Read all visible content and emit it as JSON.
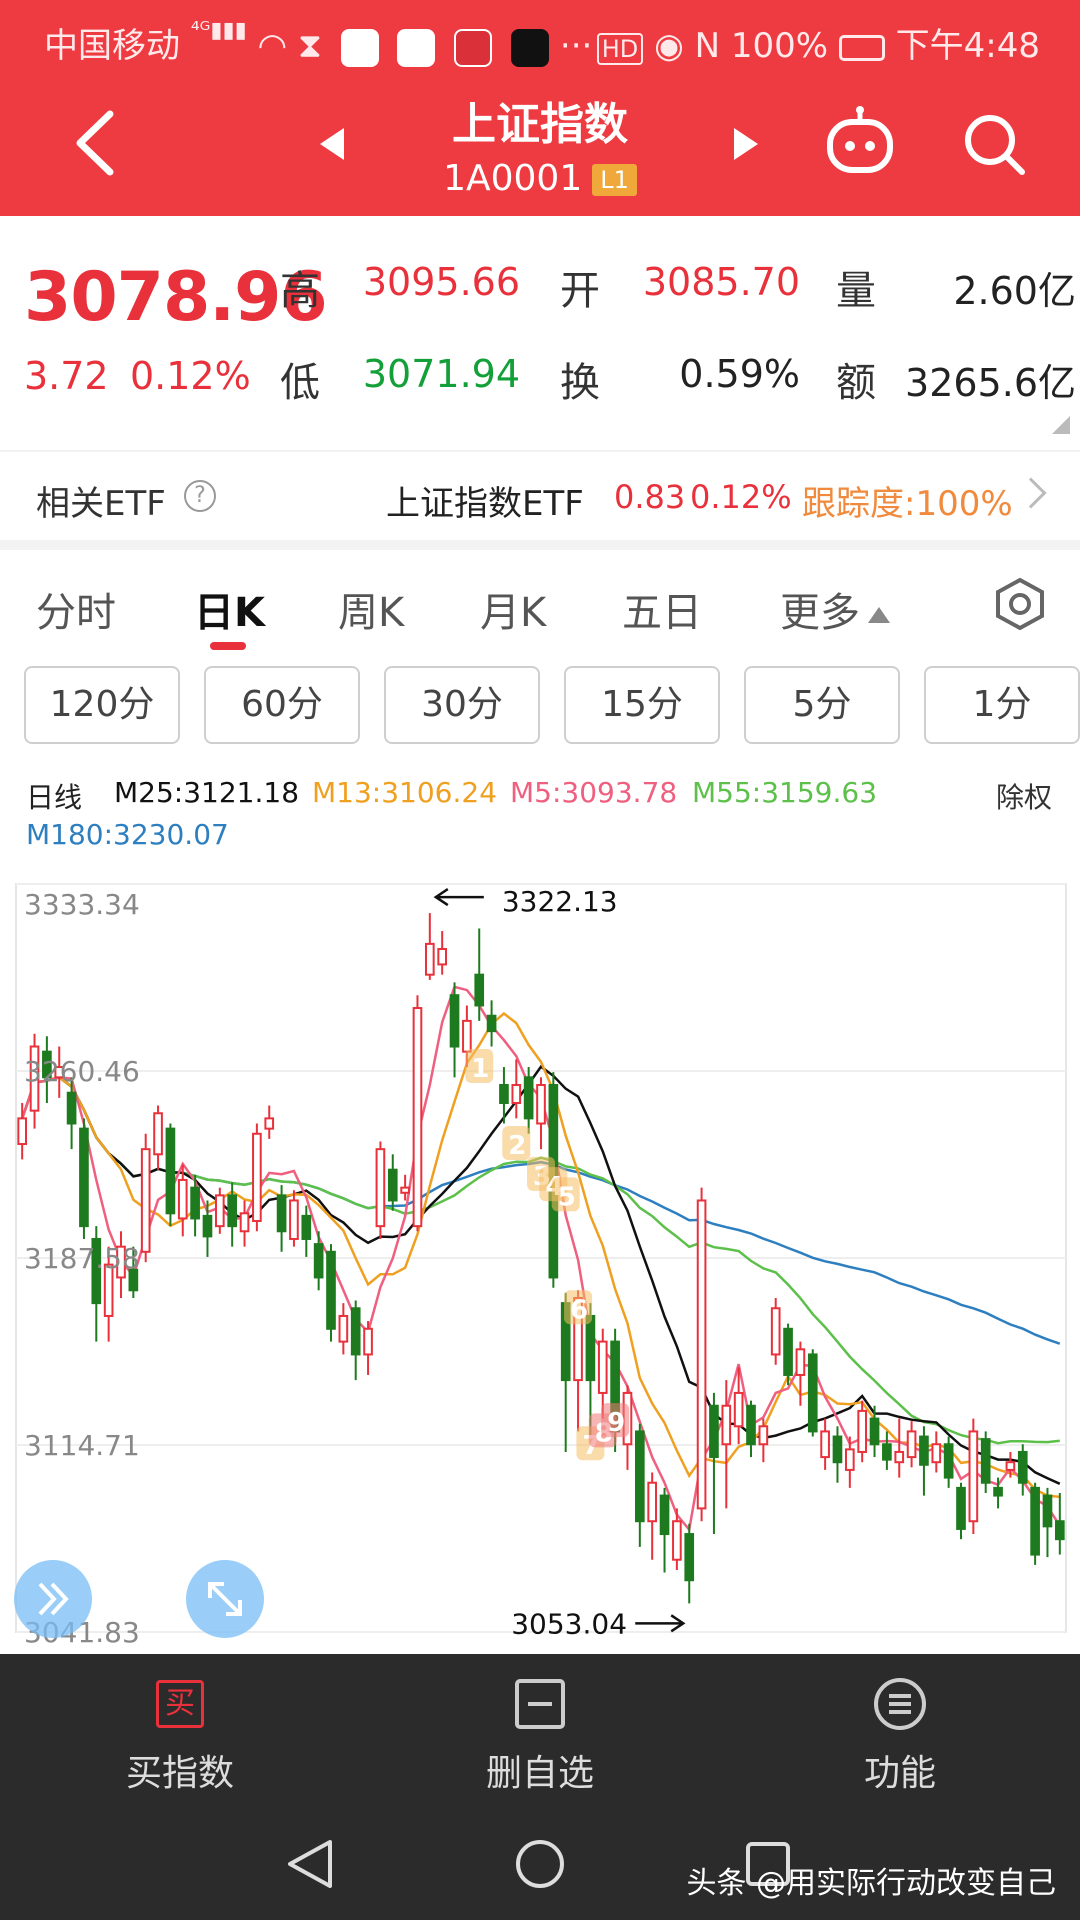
{
  "status_bar": {
    "carrier": "中国移动",
    "battery": "100%",
    "time": "下午4:48"
  },
  "header": {
    "title": "上证指数",
    "code": "1A0001",
    "level_badge": "L1"
  },
  "quote": {
    "price": "3078.96",
    "change": "3.72",
    "change_pct": "0.12%",
    "high_label": "高",
    "high": "3095.66",
    "low_label": "低",
    "low": "3071.94",
    "open_label": "开",
    "open": "3085.70",
    "turnover_label": "换",
    "turnover": "0.59%",
    "volume_label": "量",
    "volume": "2.60亿",
    "amount_label": "额",
    "amount": "3265.6亿"
  },
  "etf": {
    "label": "相关ETF",
    "name": "上证指数ETF",
    "price": "0.83",
    "pct": "0.12%",
    "tracking": "跟踪度:100%"
  },
  "tabs": [
    "分时",
    "日K",
    "周K",
    "月K",
    "五日",
    "更多"
  ],
  "minute_buttons": [
    "120分",
    "60分",
    "30分",
    "15分",
    "5分",
    "1分"
  ],
  "ma_legend": {
    "title": "日线",
    "adjust": "除权",
    "m25": "M25:3121.18",
    "m13": "M13:3106.24",
    "m5": "M5:3093.78",
    "m55": "M55:3159.63",
    "m180": "M180:3230.07"
  },
  "colors": {
    "up": "#e8313b",
    "down": "#1e7a1e",
    "m25": "#111111",
    "m13": "#f0a020",
    "m5": "#ef5f7f",
    "m55": "#5cc04a",
    "m180": "#2e7fc0"
  },
  "chart_data": {
    "type": "candlestick",
    "y_ticks": [
      "3333.34",
      "3260.46",
      "3187.58",
      "3114.71",
      "3041.83"
    ],
    "ylim": [
      3041.83,
      3333.34
    ],
    "annotations": {
      "high": "3322.13",
      "low": "3053.04"
    },
    "wave_labels": [
      "1",
      "2",
      "3",
      "4",
      "5",
      "6",
      "7",
      "8",
      "9"
    ],
    "candles": [
      {
        "o": 3232,
        "c": 3242,
        "h": 3248,
        "l": 3226
      },
      {
        "o": 3245,
        "c": 3270,
        "h": 3275,
        "l": 3238
      },
      {
        "o": 3268,
        "c": 3258,
        "h": 3274,
        "l": 3248
      },
      {
        "o": 3258,
        "c": 3262,
        "h": 3270,
        "l": 3250
      },
      {
        "o": 3252,
        "c": 3240,
        "h": 3258,
        "l": 3230
      },
      {
        "o": 3238,
        "c": 3200,
        "h": 3242,
        "l": 3195
      },
      {
        "o": 3195,
        "c": 3170,
        "h": 3200,
        "l": 3155
      },
      {
        "o": 3165,
        "c": 3185,
        "h": 3192,
        "l": 3155
      },
      {
        "o": 3180,
        "c": 3192,
        "h": 3198,
        "l": 3172
      },
      {
        "o": 3183,
        "c": 3175,
        "h": 3192,
        "l": 3172
      },
      {
        "o": 3190,
        "c": 3230,
        "h": 3236,
        "l": 3186
      },
      {
        "o": 3228,
        "c": 3244,
        "h": 3247,
        "l": 3222
      },
      {
        "o": 3238,
        "c": 3205,
        "h": 3240,
        "l": 3200
      },
      {
        "o": 3203,
        "c": 3218,
        "h": 3224,
        "l": 3196
      },
      {
        "o": 3215,
        "c": 3203,
        "h": 3220,
        "l": 3196
      },
      {
        "o": 3204,
        "c": 3196,
        "h": 3210,
        "l": 3188
      },
      {
        "o": 3200,
        "c": 3212,
        "h": 3215,
        "l": 3197
      },
      {
        "o": 3212,
        "c": 3200,
        "h": 3217,
        "l": 3192
      },
      {
        "o": 3198,
        "c": 3205,
        "h": 3210,
        "l": 3192
      },
      {
        "o": 3202,
        "c": 3236,
        "h": 3240,
        "l": 3198
      },
      {
        "o": 3238,
        "c": 3242,
        "h": 3247,
        "l": 3234
      },
      {
        "o": 3212,
        "c": 3198,
        "h": 3216,
        "l": 3190
      },
      {
        "o": 3195,
        "c": 3210,
        "h": 3214,
        "l": 3192
      },
      {
        "o": 3204,
        "c": 3195,
        "h": 3208,
        "l": 3188
      },
      {
        "o": 3193,
        "c": 3180,
        "h": 3198,
        "l": 3175
      },
      {
        "o": 3190,
        "c": 3160,
        "h": 3193,
        "l": 3155
      },
      {
        "o": 3155,
        "c": 3165,
        "h": 3170,
        "l": 3150
      },
      {
        "o": 3168,
        "c": 3150,
        "h": 3171,
        "l": 3140
      },
      {
        "o": 3150,
        "c": 3160,
        "h": 3163,
        "l": 3142
      },
      {
        "o": 3200,
        "c": 3230,
        "h": 3233,
        "l": 3195
      },
      {
        "o": 3222,
        "c": 3210,
        "h": 3228,
        "l": 3206
      },
      {
        "o": 3213,
        "c": 3215,
        "h": 3220,
        "l": 3210
      },
      {
        "o": 3200,
        "c": 3285,
        "h": 3290,
        "l": 3198
      },
      {
        "o": 3298,
        "c": 3310,
        "h": 3322,
        "l": 3296
      },
      {
        "o": 3302,
        "c": 3308,
        "h": 3315,
        "l": 3298
      },
      {
        "o": 3290,
        "c": 3270,
        "h": 3295,
        "l": 3258
      },
      {
        "o": 3268,
        "c": 3280,
        "h": 3286,
        "l": 3262
      },
      {
        "o": 3298,
        "c": 3286,
        "h": 3316,
        "l": 3280
      },
      {
        "o": 3282,
        "c": 3276,
        "h": 3288,
        "l": 3270
      },
      {
        "o": 3255,
        "c": 3248,
        "h": 3262,
        "l": 3240
      },
      {
        "o": 3248,
        "c": 3255,
        "h": 3265,
        "l": 3242
      },
      {
        "o": 3258,
        "c": 3242,
        "h": 3262,
        "l": 3236
      },
      {
        "o": 3240,
        "c": 3255,
        "h": 3258,
        "l": 3230
      },
      {
        "o": 3255,
        "c": 3180,
        "h": 3260,
        "l": 3176
      },
      {
        "o": 3170,
        "c": 3140,
        "h": 3174,
        "l": 3112
      },
      {
        "o": 3140,
        "c": 3172,
        "h": 3175,
        "l": 3120
      },
      {
        "o": 3165,
        "c": 3140,
        "h": 3170,
        "l": 3118
      },
      {
        "o": 3135,
        "c": 3155,
        "h": 3160,
        "l": 3125
      },
      {
        "o": 3155,
        "c": 3120,
        "h": 3160,
        "l": 3112
      },
      {
        "o": 3115,
        "c": 3135,
        "h": 3138,
        "l": 3105
      },
      {
        "o": 3120,
        "c": 3085,
        "h": 3123,
        "l": 3075
      },
      {
        "o": 3085,
        "c": 3100,
        "h": 3104,
        "l": 3070
      },
      {
        "o": 3095,
        "c": 3080,
        "h": 3098,
        "l": 3065
      },
      {
        "o": 3070,
        "c": 3085,
        "h": 3090,
        "l": 3066
      },
      {
        "o": 3080,
        "c": 3062,
        "h": 3084,
        "l": 3053
      },
      {
        "o": 3090,
        "c": 3210,
        "h": 3215,
        "l": 3085
      },
      {
        "o": 3130,
        "c": 3110,
        "h": 3135,
        "l": 3080
      },
      {
        "o": 3115,
        "c": 3130,
        "h": 3140,
        "l": 3090
      },
      {
        "o": 3122,
        "c": 3135,
        "h": 3145,
        "l": 3115
      },
      {
        "o": 3130,
        "c": 3115,
        "h": 3132,
        "l": 3110
      },
      {
        "o": 3115,
        "c": 3122,
        "h": 3125,
        "l": 3108
      },
      {
        "o": 3150,
        "c": 3168,
        "h": 3172,
        "l": 3146
      },
      {
        "o": 3160,
        "c": 3142,
        "h": 3162,
        "l": 3138
      },
      {
        "o": 3142,
        "c": 3152,
        "h": 3155,
        "l": 3130
      },
      {
        "o": 3150,
        "c": 3120,
        "h": 3152,
        "l": 3118
      },
      {
        "o": 3110,
        "c": 3120,
        "h": 3125,
        "l": 3105
      },
      {
        "o": 3118,
        "c": 3108,
        "h": 3122,
        "l": 3100
      },
      {
        "o": 3105,
        "c": 3113,
        "h": 3118,
        "l": 3098
      },
      {
        "o": 3112,
        "c": 3128,
        "h": 3132,
        "l": 3108
      },
      {
        "o": 3125,
        "c": 3115,
        "h": 3130,
        "l": 3110
      },
      {
        "o": 3115,
        "c": 3109,
        "h": 3120,
        "l": 3105
      },
      {
        "o": 3108,
        "c": 3112,
        "h": 3125,
        "l": 3102
      },
      {
        "o": 3110,
        "c": 3120,
        "h": 3124,
        "l": 3106
      },
      {
        "o": 3118,
        "c": 3107,
        "h": 3122,
        "l": 3095
      },
      {
        "o": 3108,
        "c": 3115,
        "h": 3120,
        "l": 3104
      },
      {
        "o": 3115,
        "c": 3102,
        "h": 3118,
        "l": 3098
      },
      {
        "o": 3098,
        "c": 3082,
        "h": 3100,
        "l": 3078
      },
      {
        "o": 3085,
        "c": 3120,
        "h": 3125,
        "l": 3080
      },
      {
        "o": 3117,
        "c": 3100,
        "h": 3120,
        "l": 3096
      },
      {
        "o": 3098,
        "c": 3095,
        "h": 3102,
        "l": 3090
      },
      {
        "o": 3105,
        "c": 3108,
        "h": 3112,
        "l": 3102
      },
      {
        "o": 3112,
        "c": 3100,
        "h": 3115,
        "l": 3095
      },
      {
        "o": 3098,
        "c": 3072,
        "h": 3100,
        "l": 3068
      },
      {
        "o": 3095,
        "c": 3083,
        "h": 3098,
        "l": 3071
      },
      {
        "o": 3085,
        "c": 3078,
        "h": 3096,
        "l": 3072
      }
    ]
  },
  "bottom_bar": {
    "buy": "买指数",
    "buy_icon_char": "买",
    "watch": "删自选",
    "func": "功能"
  },
  "watermark": "头条 @用实际行动改变自己"
}
